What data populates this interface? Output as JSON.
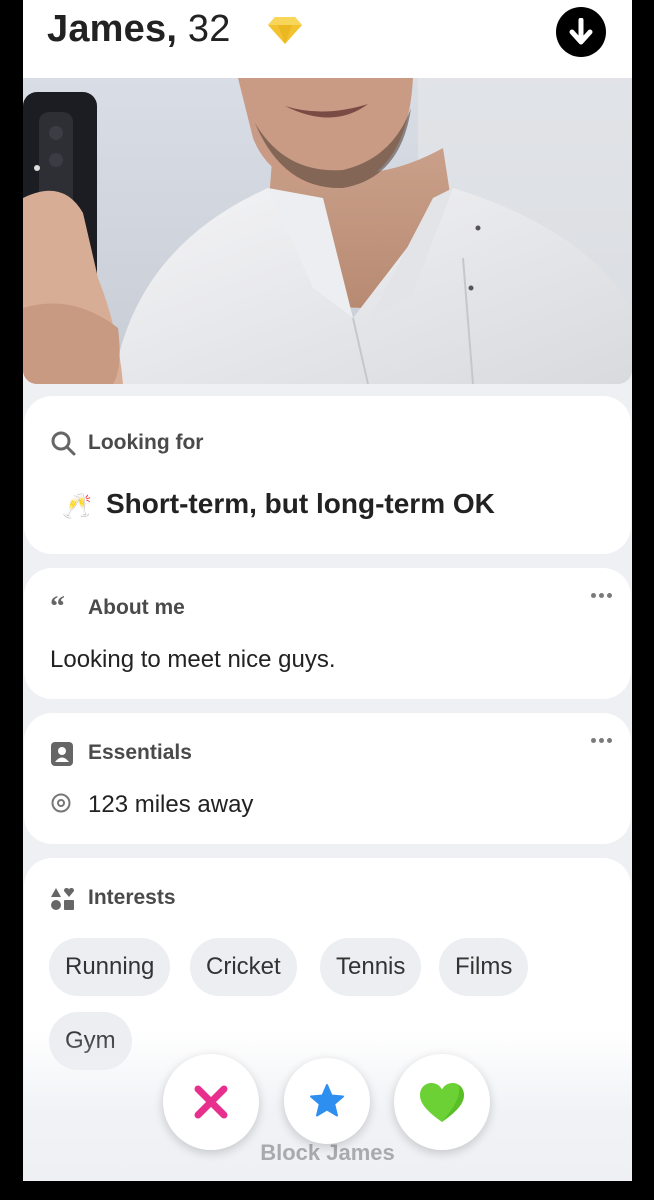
{
  "profile": {
    "name": "James,",
    "age": "32"
  },
  "looking_for": {
    "heading": "Looking for",
    "value": "Short-term, but long-term OK",
    "emoji": "🥂"
  },
  "about": {
    "heading": "About me",
    "text": "Looking to meet nice guys."
  },
  "essentials": {
    "heading": "Essentials",
    "distance": "123 miles away"
  },
  "interests": {
    "heading": "Interests",
    "items": [
      "Running",
      "Cricket",
      "Tennis",
      "Films",
      "Gym"
    ]
  },
  "footer": {
    "block_label": "Block James"
  },
  "icons": {
    "badge": "gold-diamond-icon",
    "download": "arrow-down-icon",
    "search": "search-icon",
    "quote": "quote-icon",
    "id_card": "id-card-icon",
    "location": "location-pin-icon",
    "shapes": "shapes-icon",
    "more": "more-dots-icon",
    "nope": "x-icon",
    "super_like": "star-icon",
    "like": "heart-icon"
  },
  "colors": {
    "nope": "#e7308d",
    "super_like": "#2d8ff0",
    "like": "#6bd134",
    "badge": "#f2c230"
  }
}
